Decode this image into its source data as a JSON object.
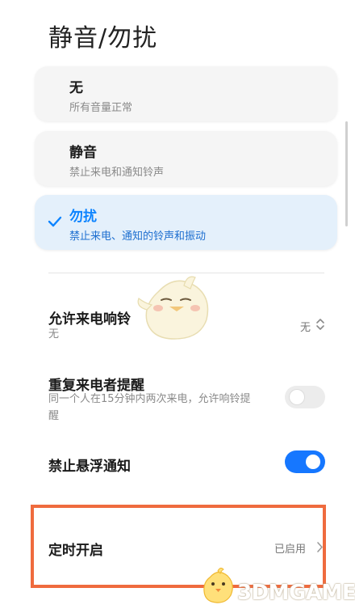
{
  "header": {
    "title": "静音/勿扰"
  },
  "modes": [
    {
      "title": "无",
      "subtitle": "所有音量正常",
      "selected": false
    },
    {
      "title": "静音",
      "subtitle": "禁止来电和通知铃声",
      "selected": false
    },
    {
      "title": "勿扰",
      "subtitle": "禁止来电、通知的铃声和振动",
      "selected": true
    }
  ],
  "settings": {
    "allow_calls": {
      "title": "允许来电响铃",
      "subtitle": "无",
      "value": "无",
      "icon": "updown-chevron-icon"
    },
    "repeat_callers": {
      "title": "重复来电者提醒",
      "subtitle_line1": "同一个人在15分钟内两次来电，允许响铃提",
      "subtitle_line2": "醒",
      "enabled": false
    },
    "block_floating": {
      "title": "禁止悬浮通知",
      "enabled": true
    },
    "schedule": {
      "title": "定时开启",
      "value": "已启用",
      "icon": "chevron-right-icon"
    }
  },
  "watermark": {
    "text": "3DMGAME"
  },
  "colors": {
    "accent": "#1677ff",
    "selected_bg": "#e4f0fb",
    "highlight": "#ef6b3e"
  }
}
